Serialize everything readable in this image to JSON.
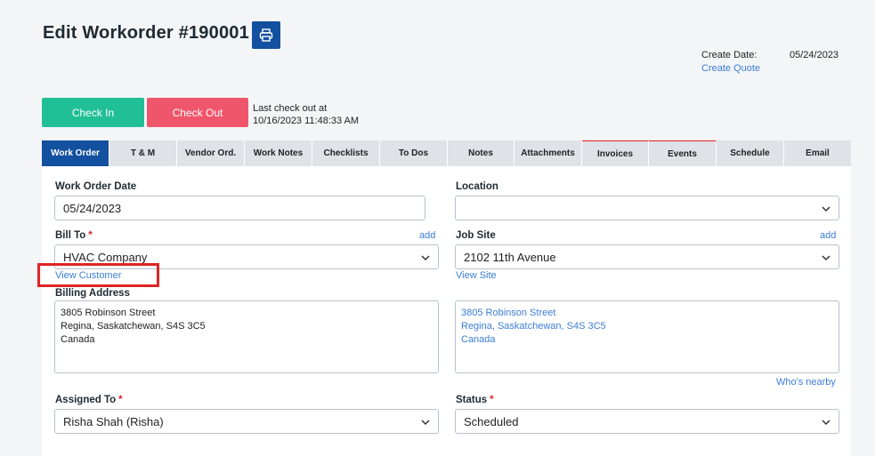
{
  "header": {
    "title": "Edit Workorder #190001",
    "create_date_label": "Create Date:",
    "create_date_value": "05/24/2023",
    "create_quote_link": "Create Quote"
  },
  "actions": {
    "check_in": "Check In",
    "check_out": "Check Out",
    "last_checkout_line1": "Last check out at",
    "last_checkout_line2": "10/16/2023 11:48:33 AM"
  },
  "tabs": [
    {
      "label": "Work Order"
    },
    {
      "label": "T & M"
    },
    {
      "label": "Vendor Ord."
    },
    {
      "label": "Work Notes"
    },
    {
      "label": "Checklists"
    },
    {
      "label": "To Dos"
    },
    {
      "label": "Notes"
    },
    {
      "label": "Attachments"
    },
    {
      "label": "Invoices"
    },
    {
      "label": "Events"
    },
    {
      "label": "Schedule"
    },
    {
      "label": "Email"
    }
  ],
  "form": {
    "work_order_date_label": "Work Order Date",
    "work_order_date_value": "05/24/2023",
    "location_label": "Location",
    "location_value": "",
    "bill_to_label": "Bill To",
    "bill_to_add": "add",
    "bill_to_value": "HVAC Company",
    "view_customer": "View Customer",
    "job_site_label": "Job Site",
    "job_site_add": "add",
    "job_site_value": "2102 11th Avenue",
    "view_site": "View Site",
    "billing_address_label": "Billing Address",
    "billing_address_value": "3805 Robinson Street\nRegina, Saskatchewan, S4S 3C5\nCanada",
    "site_address_value": "3805 Robinson Street\nRegina, Saskatchewan, S4S 3C5\nCanada",
    "whos_nearby": "Who's nearby",
    "assigned_to_label": "Assigned To",
    "assigned_to_value": "Risha Shah (Risha)",
    "status_label": "Status",
    "status_value": "Scheduled",
    "required_mark": "*"
  },
  "colors": {
    "primary": "#13509f",
    "check_in": "#21bf95",
    "check_out": "#f0566b",
    "link": "#3b7dd8",
    "highlight": "#e02424"
  },
  "icons": {
    "print": "printer-icon",
    "dropdown": "chevron-down-icon"
  }
}
